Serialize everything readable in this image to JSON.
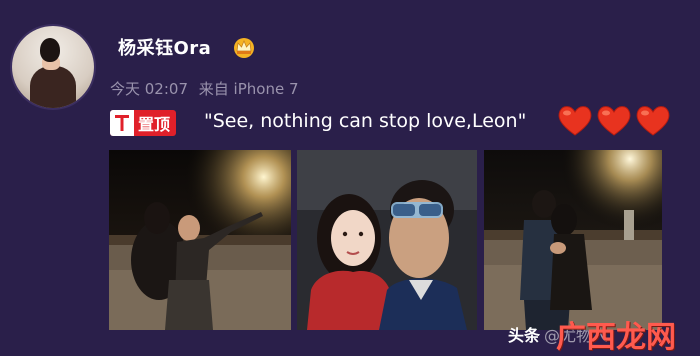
{
  "post": {
    "username": "杨采钰Ora",
    "time": "今天 02:07",
    "source": "来自 iPhone 7",
    "pin_label": "置顶",
    "text": "\"See, nothing can stop love,Leon\"",
    "icons": {
      "crown": "crown-icon",
      "pin": "pin-icon",
      "hearts": "heart-icon"
    }
  },
  "watermark": {
    "source": "头条",
    "author": "@尤物人",
    "logo_text": "广西龙网"
  },
  "colors": {
    "background": "#2a1f4a",
    "pin_badge": "#e0202a",
    "heart": "#e8331f",
    "meta_text": "#9a93ad"
  }
}
